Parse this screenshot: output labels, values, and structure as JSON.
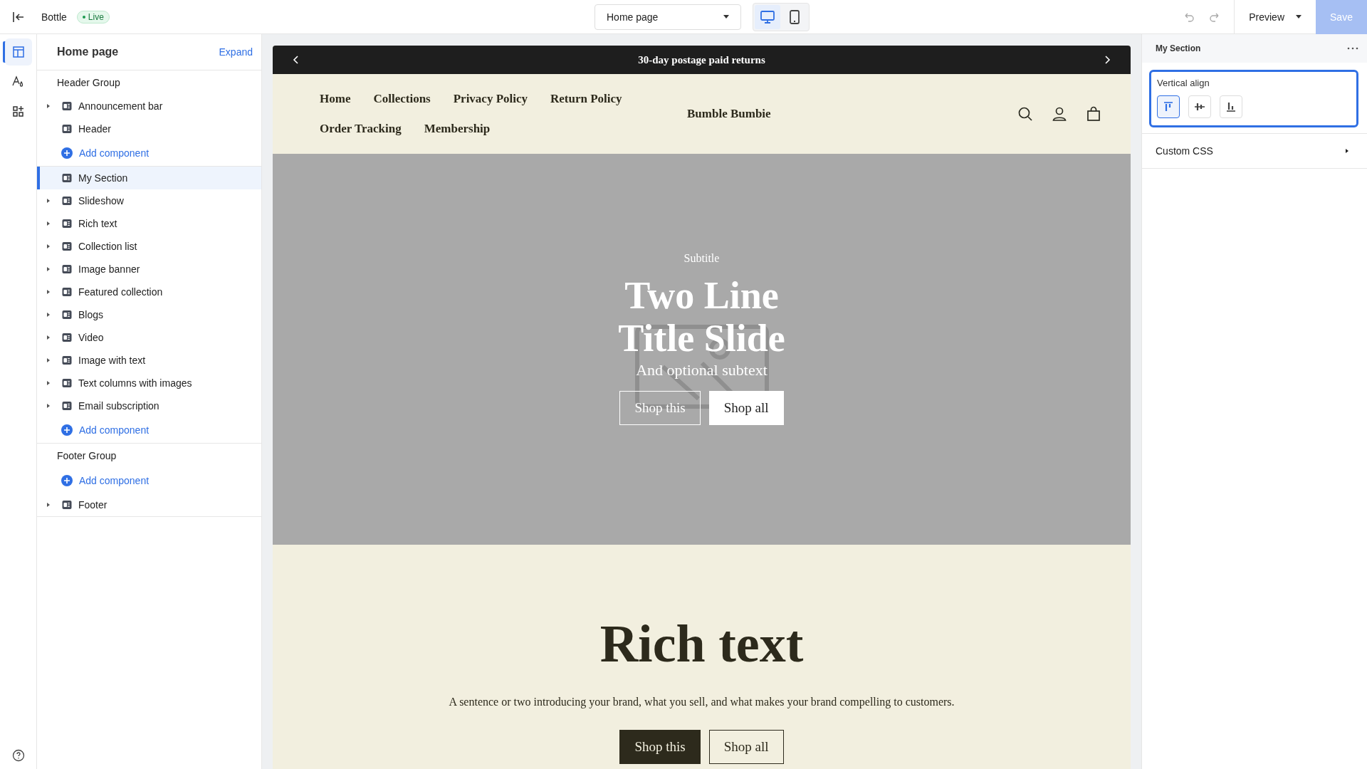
{
  "topbar": {
    "app_name": "Bottle",
    "status": "Live",
    "page_select": "Home page",
    "devices": [
      {
        "kind": "desktop",
        "selected": true
      },
      {
        "kind": "mobile",
        "selected": false
      }
    ],
    "preview": "Preview",
    "save": {
      "label": "Save",
      "disabled": true
    }
  },
  "rail": [
    {
      "kind": "sections",
      "selected": true
    },
    {
      "kind": "theme",
      "selected": false
    },
    {
      "kind": "apps",
      "selected": false
    }
  ],
  "sidebar": {
    "title": "Home page",
    "expand": "Expand",
    "groups": [
      {
        "title": "Header Group",
        "rows": [
          {
            "kind": "section",
            "label": "Announcement bar",
            "expandable": true,
            "selected": false
          },
          {
            "kind": "section",
            "label": "Header",
            "expandable": false,
            "selected": false
          },
          {
            "kind": "add",
            "label": "Add component"
          }
        ]
      },
      {
        "rows": [
          {
            "kind": "section",
            "label": "My Section",
            "expandable": false,
            "selected": true
          },
          {
            "kind": "section",
            "label": "Slideshow",
            "expandable": true,
            "selected": false
          },
          {
            "kind": "section",
            "label": "Rich text",
            "expandable": true,
            "selected": false
          },
          {
            "kind": "section",
            "label": "Collection list",
            "expandable": true,
            "selected": false
          },
          {
            "kind": "section",
            "label": "Image banner",
            "expandable": true,
            "selected": false
          },
          {
            "kind": "section",
            "label": "Featured collection",
            "expandable": true,
            "selected": false
          },
          {
            "kind": "section",
            "label": "Blogs",
            "expandable": true,
            "selected": false
          },
          {
            "kind": "section",
            "label": "Video",
            "expandable": true,
            "selected": false
          },
          {
            "kind": "section",
            "label": "Image with text",
            "expandable": true,
            "selected": false
          },
          {
            "kind": "section",
            "label": "Text columns with images",
            "expandable": true,
            "selected": false
          },
          {
            "kind": "section",
            "label": "Email subscription",
            "expandable": true,
            "selected": false
          },
          {
            "kind": "add",
            "label": "Add component"
          }
        ]
      },
      {
        "title": "Footer Group",
        "rows": [
          {
            "kind": "add",
            "label": "Add component"
          },
          {
            "kind": "section",
            "label": "Footer",
            "expandable": true,
            "selected": false
          }
        ]
      }
    ]
  },
  "preview": {
    "announcement": "30-day postage paid returns",
    "nav_links": [
      "Home",
      "Collections",
      "Privacy Policy",
      "Return Policy",
      "Order Tracking",
      "Membership"
    ],
    "brand": "Bumble Bumbie",
    "hero": {
      "subtitle": "Subtitle",
      "title": "Two Line Title Slide",
      "subtext": "And optional subtext",
      "buttons": [
        {
          "label": "Shop this",
          "kind": "outline"
        },
        {
          "label": "Shop all",
          "kind": "solid"
        }
      ]
    },
    "rich_text": {
      "title": "Rich text",
      "text": "A sentence or two introducing your brand, what you sell, and what makes your brand compelling to customers.",
      "buttons": [
        {
          "label": "Shop this",
          "kind": "solid"
        },
        {
          "label": "Shop all",
          "kind": "outline"
        }
      ]
    }
  },
  "settings": {
    "title": "My Section",
    "vertical_align": {
      "label": "Vertical align",
      "options": [
        {
          "kind": "top",
          "selected": true
        },
        {
          "kind": "middle",
          "selected": false
        },
        {
          "kind": "bottom",
          "selected": false
        }
      ]
    },
    "custom_css": "Custom CSS"
  }
}
